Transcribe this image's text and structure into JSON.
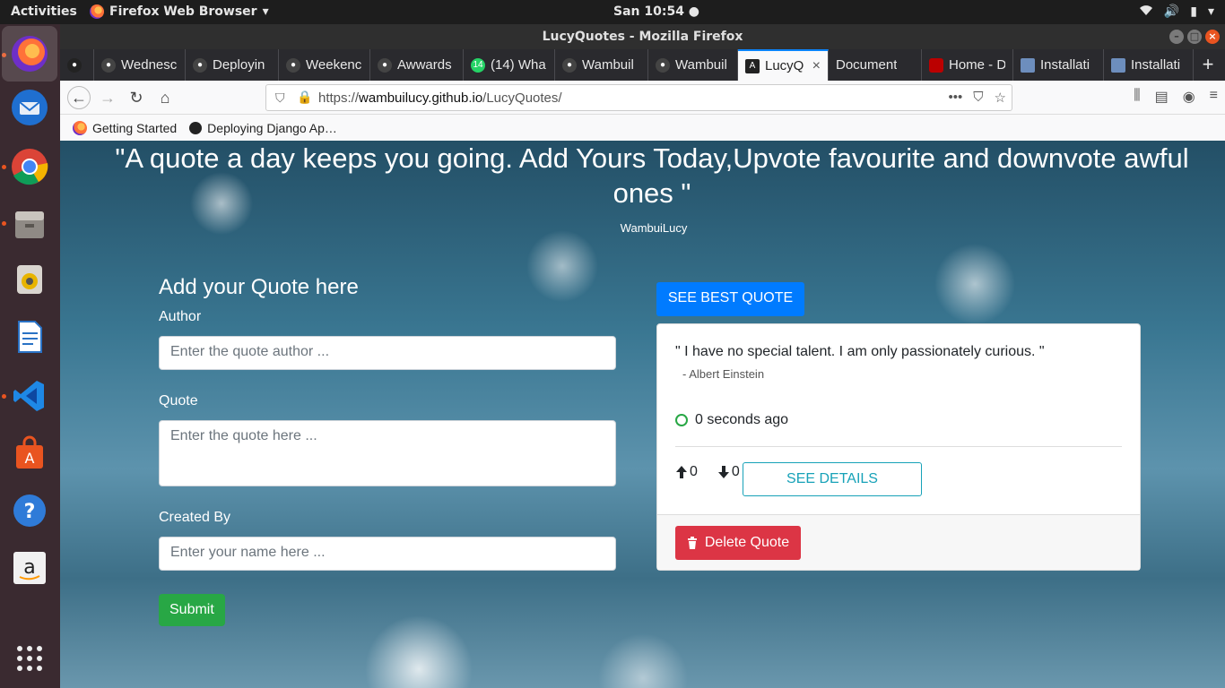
{
  "topbar": {
    "activities": "Activities",
    "app_name": "Firefox Web Browser",
    "clock": "San 10:54"
  },
  "window": {
    "title": "LucyQuotes - Mozilla Firefox"
  },
  "tabs": [
    {
      "label": "",
      "icon": "github-icon"
    },
    {
      "label": "Wednesc",
      "icon": "github-icon"
    },
    {
      "label": "Deployin",
      "icon": "github-icon"
    },
    {
      "label": "Weekenc",
      "icon": "github-icon"
    },
    {
      "label": "Awwards",
      "icon": "github-icon"
    },
    {
      "label": "(14) Wha",
      "icon": "whatsapp-icon"
    },
    {
      "label": "Wambuil",
      "icon": "github-icon"
    },
    {
      "label": "Wambuil",
      "icon": "github-icon"
    },
    {
      "label": "LucyQ",
      "icon": "angular-icon"
    },
    {
      "label": "Document",
      "icon": ""
    },
    {
      "label": "Home - D",
      "icon": "home-icon"
    },
    {
      "label": "Installati",
      "icon": "doc-icon"
    },
    {
      "label": "Installati",
      "icon": "doc-icon"
    }
  ],
  "urlbar": {
    "scheme": "https://",
    "host": "wambuilucy.github.io",
    "path": "/LucyQuotes/"
  },
  "bookmarks": [
    {
      "label": "Getting Started",
      "icon": "firefox-icon"
    },
    {
      "label": "Deploying Django Ap…",
      "icon": "github-icon"
    }
  ],
  "page": {
    "headline": "\"A quote a day keeps you going. Add Yours Today,Upvote favourite and downvote awful ones \"",
    "byline": "WambuiLucy",
    "form": {
      "title": "Add your Quote here",
      "author_label": "Author",
      "author_placeholder": "Enter the quote author ...",
      "quote_label": "Quote",
      "quote_placeholder": "Enter the quote here ...",
      "created_label": "Created By",
      "created_placeholder": "Enter your name here ...",
      "submit": "Submit"
    },
    "best_quote_button": "SEE BEST QUOTE",
    "quote_card": {
      "text": "\" I have no special talent. I am only passionately curious. \"",
      "author": "- Albert Einstein",
      "time": "0 seconds ago",
      "upvotes": "0",
      "downvotes": "0",
      "details_button": "SEE DETAILS",
      "delete_button": "Delete Quote"
    }
  },
  "colors": {
    "primary": "#007bff",
    "success": "#28a745",
    "danger": "#dc3545",
    "info": "#17a2b8",
    "ubuntu_orange": "#e95420"
  }
}
